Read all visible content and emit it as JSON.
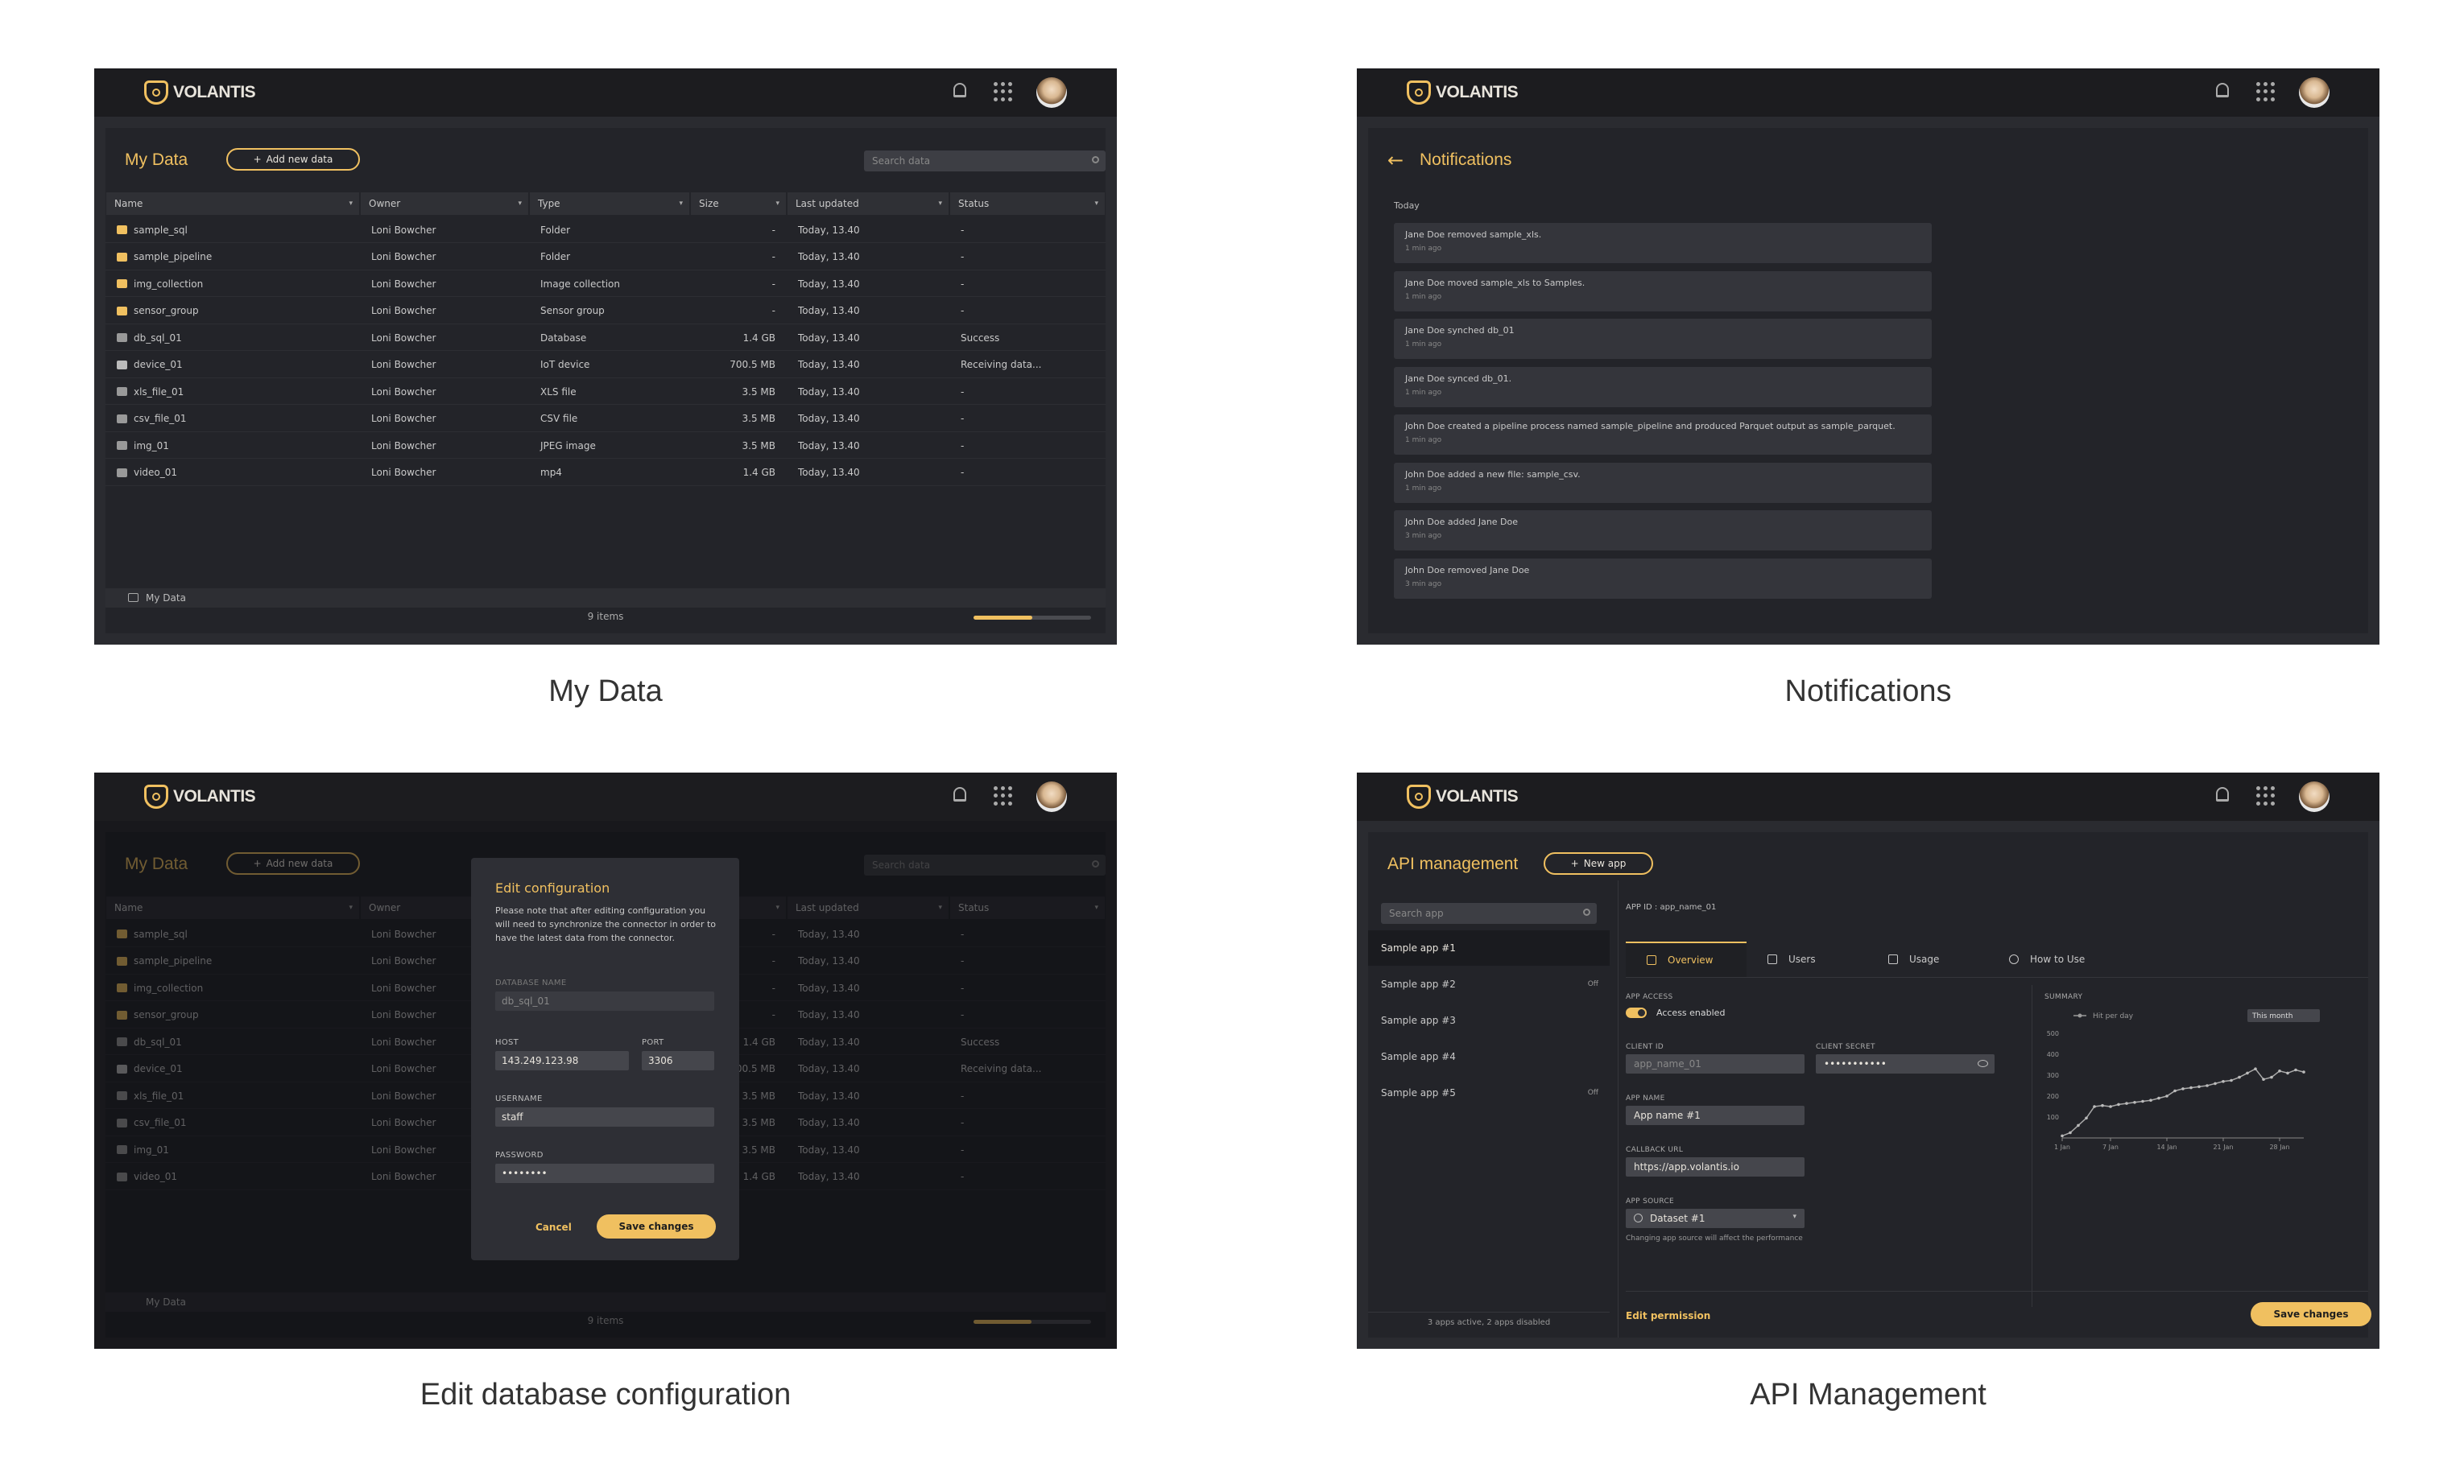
{
  "brand": {
    "name": "VOLANTIS"
  },
  "colors": {
    "accent": "#f0c060",
    "bg": "#232429",
    "topbar": "#1c1c1f"
  },
  "captions": [
    "My Data",
    "Notifications",
    "Edit database configuration",
    "API Management"
  ],
  "mydata": {
    "title": "My Data",
    "add_button": "Add new data",
    "search_placeholder": "Search data",
    "columns": [
      "Name",
      "Owner",
      "Type",
      "Size",
      "Last updated",
      "Status"
    ],
    "rows": [
      {
        "name": "sample_sql",
        "icon": "folder-icon",
        "owner": "Loni Bowcher",
        "type": "Folder",
        "size": "-",
        "updated": "Today, 13.40",
        "status": "-"
      },
      {
        "name": "sample_pipeline",
        "icon": "folder-icon",
        "owner": "Loni Bowcher",
        "type": "Folder",
        "size": "-",
        "updated": "Today, 13.40",
        "status": "-"
      },
      {
        "name": "img_collection",
        "icon": "image-collection-icon",
        "owner": "Loni Bowcher",
        "type": "Image collection",
        "size": "-",
        "updated": "Today, 13.40",
        "status": "-"
      },
      {
        "name": "sensor_group",
        "icon": "folder-icon",
        "owner": "Loni Bowcher",
        "type": "Sensor group",
        "size": "-",
        "updated": "Today, 13.40",
        "status": "-"
      },
      {
        "name": "db_sql_01",
        "icon": "database-icon",
        "owner": "Loni Bowcher",
        "type": "Database",
        "size": "1.4 GB",
        "updated": "Today, 13.40",
        "status": "Success"
      },
      {
        "name": "device_01",
        "icon": "wifi-icon",
        "owner": "Loni Bowcher",
        "type": "IoT device",
        "size": "700.5 MB",
        "updated": "Today, 13.40",
        "status": "Receiving data..."
      },
      {
        "name": "xls_file_01",
        "icon": "file-icon",
        "owner": "Loni Bowcher",
        "type": "XLS file",
        "size": "3.5 MB",
        "updated": "Today, 13.40",
        "status": "-"
      },
      {
        "name": "csv_file_01",
        "icon": "file-icon",
        "owner": "Loni Bowcher",
        "type": "CSV file",
        "size": "3.5 MB",
        "updated": "Today, 13.40",
        "status": "-"
      },
      {
        "name": "img_01",
        "icon": "image-icon",
        "owner": "Loni Bowcher",
        "type": "JPEG image",
        "size": "3.5 MB",
        "updated": "Today, 13.40",
        "status": "-"
      },
      {
        "name": "video_01",
        "icon": "video-icon",
        "owner": "Loni Bowcher",
        "type": "mp4",
        "size": "1.4 GB",
        "updated": "Today, 13.40",
        "status": "-"
      }
    ],
    "footer_path": "My Data",
    "item_count": "9 items",
    "scroll_fraction": 0.5
  },
  "notifications": {
    "title": "Notifications",
    "section": "Today",
    "items": [
      {
        "text": "Jane Doe removed sample_xls.",
        "time": "1 min ago"
      },
      {
        "text": "Jane Doe moved sample_xls to Samples.",
        "time": "1 min ago"
      },
      {
        "text": "Jane Doe synched db_01",
        "time": "1 min ago"
      },
      {
        "text": "Jane Doe synced db_01.",
        "time": "1 min ago"
      },
      {
        "text": "John Doe created a pipeline process named sample_pipeline and produced Parquet output as sample_parquet.",
        "time": "1 min ago"
      },
      {
        "text": "John Doe added a new file: sample_csv.",
        "time": "1 min ago"
      },
      {
        "text": "John Doe added Jane Doe",
        "time": "3 min ago"
      },
      {
        "text": "John Doe removed Jane Doe",
        "time": "3 min ago"
      }
    ]
  },
  "edit_config": {
    "title": "Edit configuration",
    "description": "Please note that after editing configuration you will need to synchronize the connector in order to have the latest data from the connector.",
    "db_name_label": "DATABASE NAME",
    "db_name_value": "db_sql_01",
    "host_label": "HOST",
    "host_value": "143.249.123.98",
    "port_label": "PORT",
    "port_value": "3306",
    "username_label": "USERNAME",
    "username_value": "staff",
    "password_label": "PASSWORD",
    "password_value": "••••••••",
    "cancel": "Cancel",
    "save": "Save changes"
  },
  "api": {
    "title": "API management",
    "new_app": "New app",
    "search_placeholder": "Search app",
    "apps": [
      {
        "name": "Sample app #1",
        "badge": ""
      },
      {
        "name": "Sample app #2",
        "badge": "Off"
      },
      {
        "name": "Sample app #3",
        "badge": ""
      },
      {
        "name": "Sample app #4",
        "badge": ""
      },
      {
        "name": "Sample app #5",
        "badge": "Off"
      }
    ],
    "apps_footer": "3 apps active, 2 apps disabled",
    "app_id_label": "APP ID :",
    "app_id_value": "app_name_01",
    "tabs": [
      "Overview",
      "Users",
      "Usage",
      "How to Use"
    ],
    "app_access_label": "APP ACCESS",
    "access_value": "Access enabled",
    "client_id_label": "CLIENT ID",
    "client_id_value": "app_name_01",
    "client_secret_label": "CLIENT SECRET",
    "client_secret_value": "•••••••••••",
    "app_name_label": "APP NAME",
    "app_name_value": "App name #1",
    "callback_label": "CALLBACK URL",
    "callback_value": "https://app.volantis.io",
    "source_label": "APP SOURCE",
    "source_value": "Dataset #1",
    "source_hint": "Changing app source will affect the performance",
    "summary_label": "SUMMARY",
    "legend": "Hit per day",
    "period": "This month",
    "edit_permission": "Edit permission",
    "save": "Save changes"
  },
  "chart_data": {
    "type": "line",
    "title": "",
    "xlabel": "",
    "ylabel": "",
    "x_ticks": [
      "1 Jan",
      "7 Jan",
      "14 Jan",
      "21 Jan",
      "28 Jan"
    ],
    "y_ticks": [
      100,
      200,
      300,
      400,
      500
    ],
    "ylim": [
      0,
      500
    ],
    "xlim": [
      1,
      31
    ],
    "series": [
      {
        "name": "Hit per day",
        "x": [
          1,
          2,
          3,
          4,
          5,
          6,
          7,
          8,
          9,
          10,
          11,
          12,
          13,
          14,
          15,
          16,
          17,
          18,
          19,
          20,
          21,
          22,
          23,
          24,
          25,
          26,
          27,
          28,
          29,
          30,
          31
        ],
        "values": [
          10,
          25,
          60,
          95,
          150,
          155,
          150,
          160,
          165,
          170,
          175,
          180,
          190,
          200,
          225,
          235,
          240,
          245,
          250,
          260,
          270,
          275,
          290,
          310,
          330,
          280,
          290,
          320,
          310,
          325,
          315
        ]
      }
    ]
  }
}
